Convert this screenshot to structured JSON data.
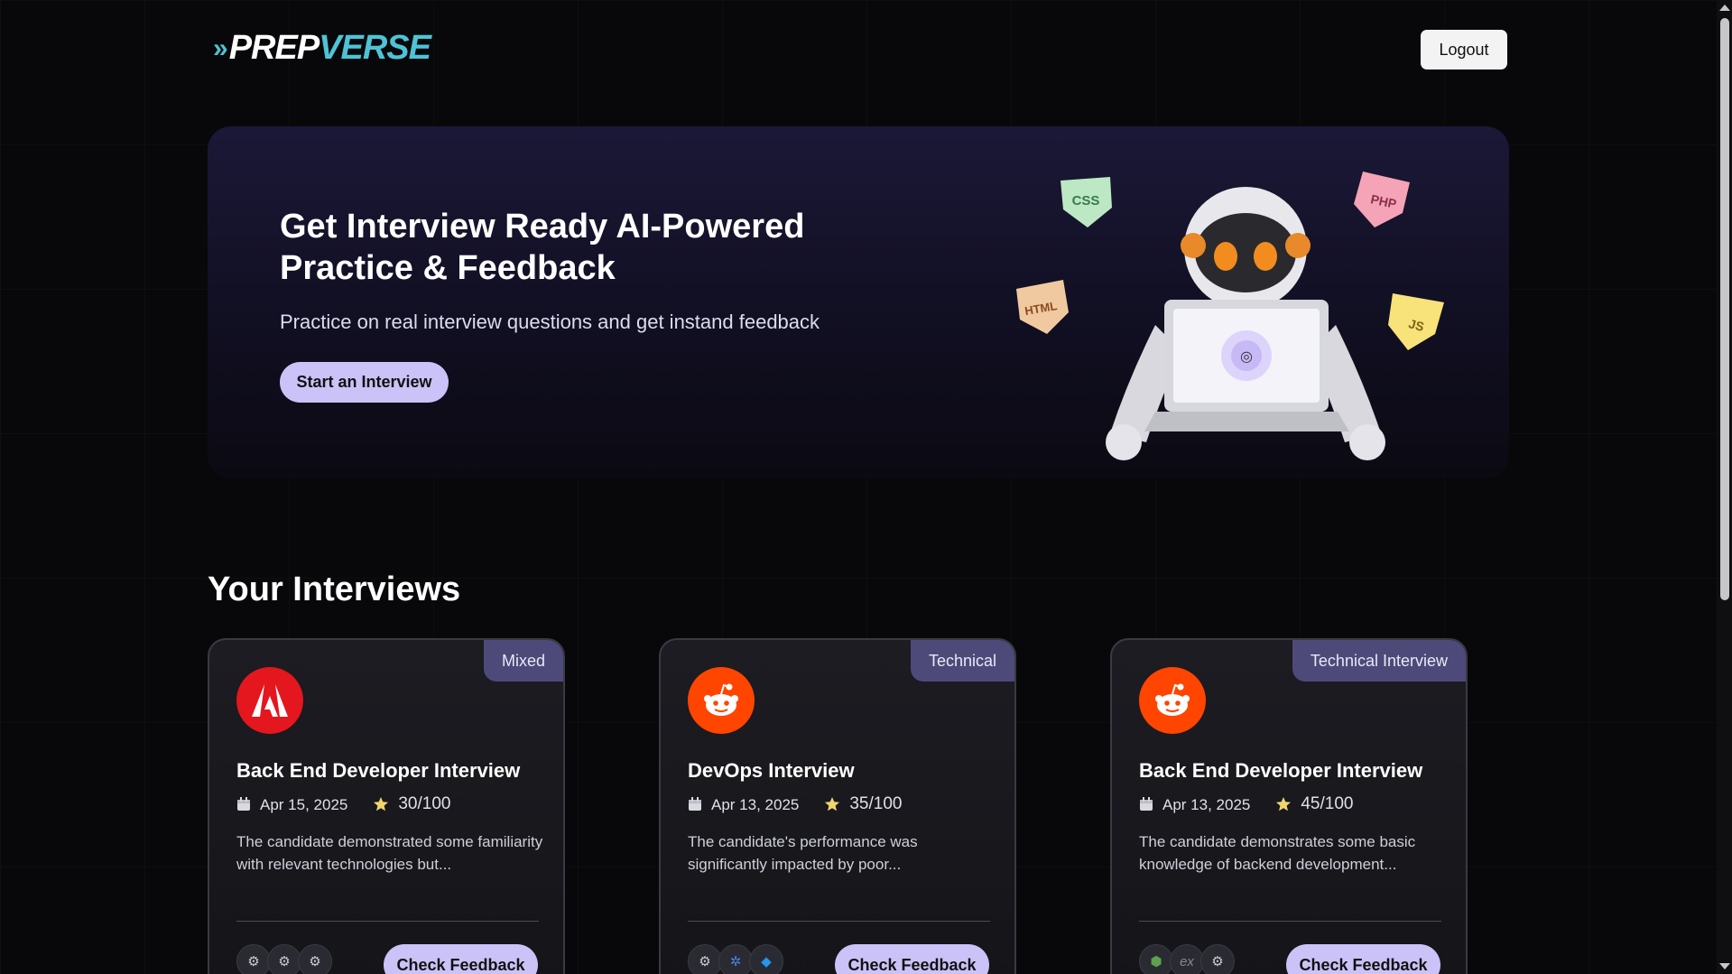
{
  "header": {
    "logo_prefix": "»",
    "logo_prep": "PREP",
    "logo_verse": "VERSE",
    "logout_label": "Logout"
  },
  "hero": {
    "title": "Get Interview Ready AI-Powered Practice & Feedback",
    "subtitle": "Practice on real interview questions and get instand feedback",
    "cta_label": "Start an Interview",
    "badges": [
      "CSS",
      "PHP",
      "HTML",
      "JS"
    ]
  },
  "section": {
    "title": "Your Interviews"
  },
  "interviews": [
    {
      "tag": "Mixed",
      "company_icon": "adobe-icon",
      "title": "Back End Developer Interview",
      "date": "Apr 15, 2025",
      "score": "30/100",
      "description": "The candidate demonstrated some familiarity with relevant technologies but...",
      "tech_icons": [
        "gear-icon",
        "gear-icon",
        "gear-icon"
      ],
      "button_label": "Check Feedback"
    },
    {
      "tag": "Technical",
      "company_icon": "reddit-icon",
      "title": "DevOps Interview",
      "date": "Apr 13, 2025",
      "score": "35/100",
      "description": "The candidate's performance was significantly impacted by poor...",
      "tech_icons": [
        "gear-icon",
        "kubernetes-icon",
        "docker-icon"
      ],
      "button_label": "Check Feedback"
    },
    {
      "tag": "Technical Interview",
      "company_icon": "reddit-icon",
      "title": "Back End Developer Interview",
      "date": "Apr 13, 2025",
      "score": "45/100",
      "description": "The candidate demonstrates some basic knowledge of backend development...",
      "tech_icons": [
        "nodejs-icon",
        "express-icon",
        "gear-icon"
      ],
      "button_label": "Check Feedback"
    }
  ],
  "colors": {
    "accent": "#cbc3f7",
    "logo_cyan": "#4ec3d6",
    "adobe_red": "#e3171d",
    "reddit_orange": "#ff4500",
    "tag_bg": "#4d4a7a"
  }
}
